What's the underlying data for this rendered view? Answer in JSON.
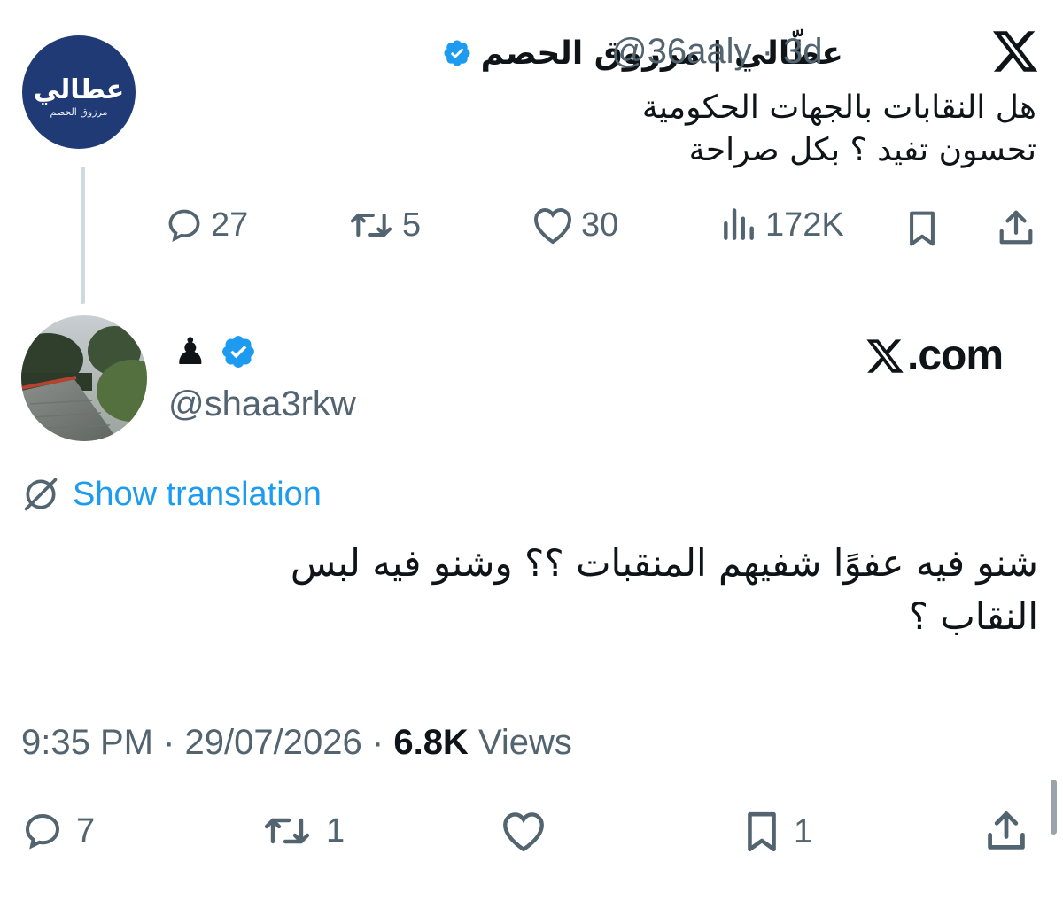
{
  "parent_tweet": {
    "display_name": "عطّالي | مرزوق الحصم",
    "verified": true,
    "handle": "@36aaly",
    "separator": "·",
    "time_ago": "3d",
    "avatar_logo_text": "عطالي",
    "avatar_logo_subtext": "مرزوق الحصم",
    "text_lines": [
      "هل النقابات بالجهات الحكومية",
      "تحسون تفيد ؟ بكل صراحة"
    ],
    "metrics": {
      "replies": "27",
      "retweets": "5",
      "likes": "30",
      "views": "172K"
    }
  },
  "reply_tweet": {
    "display_name": "♟",
    "verified": true,
    "handle": "@shaa3rkw",
    "brand_label": ".com",
    "show_translation": "Show translation",
    "text_lines": [
      "شنو فيه عفوًا شفيهم المنقبات ؟؟ وشنو فيه لبس",
      "النقاب  ؟"
    ],
    "time": "9:35 PM",
    "date": "29/07/2026",
    "separator": "·",
    "views_count": "6.8K",
    "views_label": "Views",
    "metrics": {
      "replies": "7",
      "retweets": "1",
      "bookmarks": "1"
    }
  },
  "colors": {
    "text": "#0f1419",
    "secondary": "#536471",
    "link": "#1d9bf0",
    "verified": "#1d9bf0",
    "thread_line": "#cfd9de",
    "avatar_bg": "#1f3a75"
  }
}
